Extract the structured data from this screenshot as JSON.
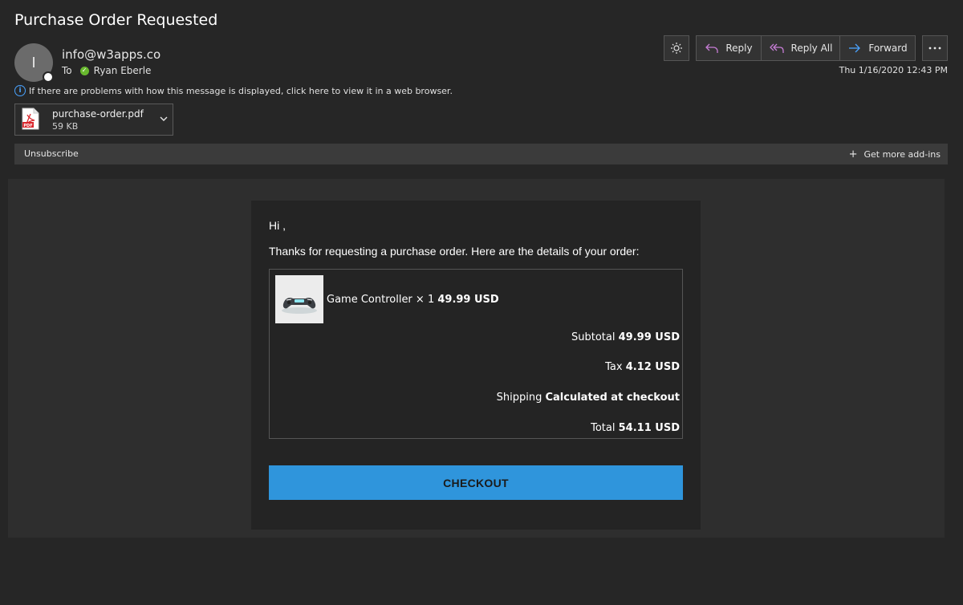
{
  "email": {
    "subject": "Purchase Order Requested",
    "avatar_initial": "I",
    "sender": "info@w3apps.co",
    "to_label": "To",
    "recipient": "Ryan Eberle",
    "info_notice": "If there are problems with how this message is displayed, click here to view it in a web browser.",
    "date": "Thu 1/16/2020 12:43 PM"
  },
  "attachment": {
    "name": "purchase-order.pdf",
    "size": "59 KB",
    "icon": "pdf-icon"
  },
  "toolbar": {
    "theme_icon": "sun-icon",
    "reply_label": "Reply",
    "reply_all_label": "Reply All",
    "forward_label": "Forward",
    "more_icon": "ellipsis-icon"
  },
  "addins_bar": {
    "unsubscribe_label": "Unsubscribe",
    "get_addins_label": "Get more add-ins"
  },
  "message": {
    "greeting": "Hi ,",
    "intro": "Thanks for requesting a purchase order. Here are the details of your order:",
    "product": {
      "name_qty": "Game Controller × 1",
      "price": "49.99 USD"
    },
    "subtotal_label": "Subtotal",
    "subtotal_value": "49.99 USD",
    "tax_label": "Tax",
    "tax_value": "4.12 USD",
    "shipping_label": "Shipping",
    "shipping_value": "Calculated at checkout",
    "total_label": "Total",
    "total_value": "54.11 USD",
    "checkout_label": "CHECKOUT"
  },
  "colors": {
    "accent": "#2f95dc",
    "background": "#262626",
    "presence_ok": "#68b82e",
    "reply_icon": "#c77dd6",
    "forward_icon": "#4aa3ff"
  }
}
